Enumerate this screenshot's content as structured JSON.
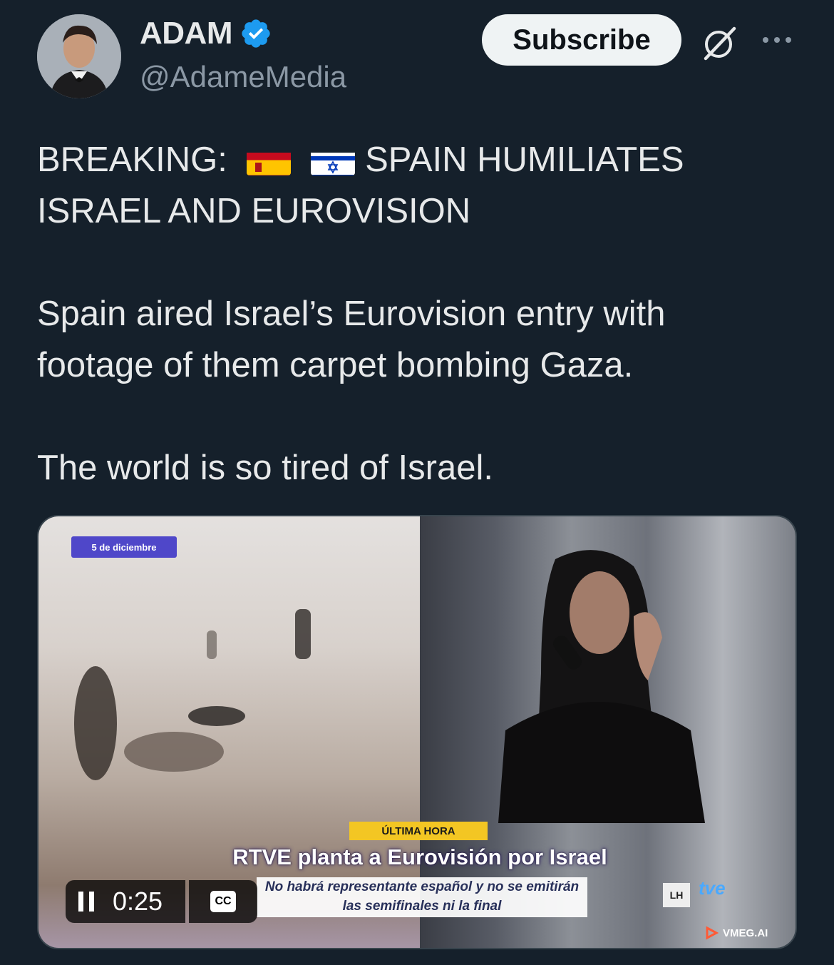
{
  "author": {
    "name": "ADAM",
    "handle": "@AdameMedia"
  },
  "actions": {
    "subscribe_label": "Subscribe"
  },
  "icons": {
    "verified": "verified-badge-icon",
    "grok": "grok-icon",
    "more": "more-dots-icon",
    "pause": "pause-icon",
    "cc": "closed-captions-icon"
  },
  "tweet": {
    "line1_prefix": "BREAKING:",
    "line1_suffix": "SPAIN HUMILIATES",
    "line2": "ISRAEL AND EUROVISION",
    "para2": "Spain aired Israel’s Eurovision entry with footage of them carpet bombing Gaza.",
    "para3": "The world is so tired of Israel."
  },
  "video": {
    "date_chip": "5 de diciembre",
    "ultima_hora": "ÚLTIMA HORA",
    "headline": "RTVE planta a Eurovisión por Israel",
    "subline": "No habrá representante español y no se emitirán las semifinales ni la final",
    "channel_lh": "LH",
    "channel_tve": "tve",
    "watermark": "VMEG.AI",
    "current_time": "0:25",
    "cc_label": "CC"
  },
  "colors": {
    "background": "#15202b",
    "verified": "#1d9bf0",
    "handle": "#8b98a5"
  }
}
